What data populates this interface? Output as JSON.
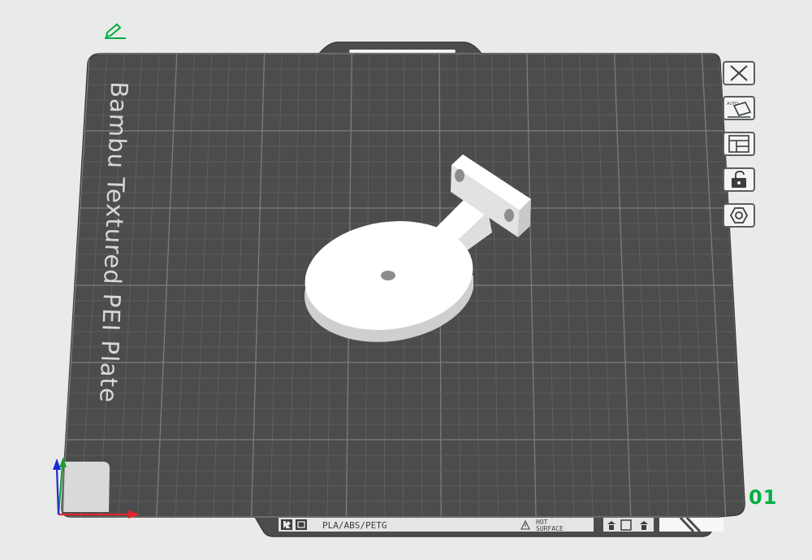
{
  "plate": {
    "label": "Bambu Textured PEI Plate",
    "number": "01",
    "materials": "PLA/ABS/PETG",
    "warning_line1": "HOT",
    "warning_line2": "SURFACE"
  },
  "colors": {
    "background": "#e9eaea",
    "plate": "#4b4d4c",
    "grid": "#6e706f",
    "accent": "#00ae42",
    "model": "#ffffff",
    "x_axis": "#e5242b",
    "y_axis": "#1c9a3d",
    "z_axis": "#1a2ed0"
  },
  "icons": {
    "edit": "pencil-icon",
    "close": "close-icon",
    "auto_orient": "auto-orient-icon",
    "arrange": "arrange-layout-icon",
    "lock": "unlock-icon",
    "settings": "hexagon-settings-icon"
  }
}
